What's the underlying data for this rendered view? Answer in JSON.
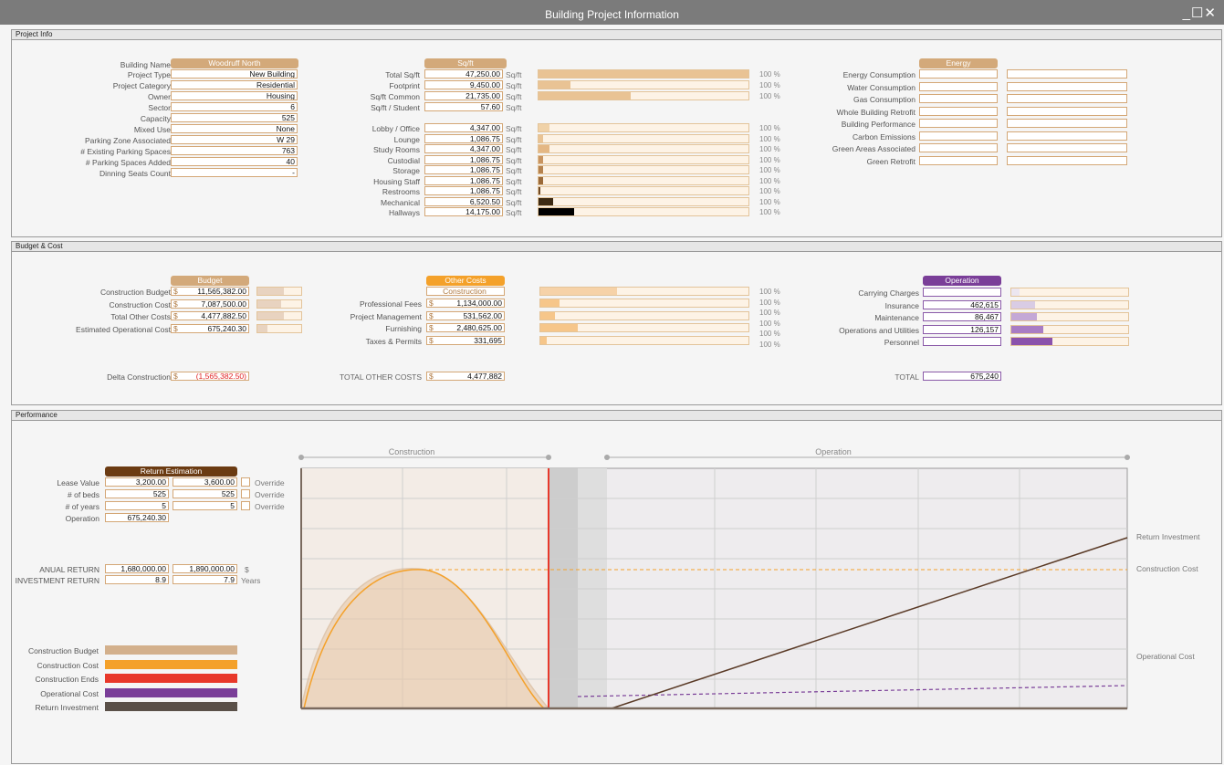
{
  "window": {
    "title": "Building Project Information",
    "controls": "_☐✕"
  },
  "project_info": {
    "header": "Project Info",
    "building_name_label": "Building Name",
    "building_name": "Woodruff North",
    "fields": [
      {
        "label": "Project Type",
        "value": "New Building"
      },
      {
        "label": "Project Category",
        "value": "Residential"
      },
      {
        "label": "Owner",
        "value": "Housing"
      },
      {
        "label": "Sector",
        "value": "6"
      },
      {
        "label": "Capacity",
        "value": "525"
      },
      {
        "label": "Mixed Use",
        "value": "None"
      },
      {
        "label": "Parking Zone Associated",
        "value": "W 29"
      },
      {
        "label": "# Existing Parking Spaces",
        "value": "763"
      },
      {
        "label": "# Parking Spaces Added",
        "value": "40"
      },
      {
        "label": "Dinning Seats Count",
        "value": "-"
      }
    ],
    "sqft_pill": "Sq/ft",
    "sqft_top": [
      {
        "label": "Total Sq/ft",
        "value": "47,250.00",
        "unit": "Sq/ft",
        "fill": 1.0,
        "pct": "100 %"
      },
      {
        "label": "Footprint",
        "value": "9,450.00",
        "unit": "Sq/ft",
        "fill": 0.15,
        "pct": "100 %"
      },
      {
        "label": "Sq/ft Common",
        "value": "21,735.00",
        "unit": "Sq/ft",
        "fill": 0.44,
        "pct": "100 %"
      },
      {
        "label": "Sq/ft / Student",
        "value": "57.60",
        "unit": "Sq/ft"
      }
    ],
    "sqft_rooms": [
      {
        "label": "Lobby / Office",
        "value": "4,347.00",
        "unit": "Sq/ft",
        "fill": 0.05,
        "pct": "100 %",
        "color": "#f0d2a8"
      },
      {
        "label": "Lounge",
        "value": "1,086.75",
        "unit": "Sq/ft",
        "fill": 0.02,
        "pct": "100 %",
        "color": "#e9c394"
      },
      {
        "label": "Study Rooms",
        "value": "4,347.00",
        "unit": "Sq/ft",
        "fill": 0.05,
        "pct": "100 %",
        "color": "#e4b784"
      },
      {
        "label": "Custodial",
        "value": "1,086.75",
        "unit": "Sq/ft",
        "fill": 0.02,
        "pct": "100 %",
        "color": "#c89460"
      },
      {
        "label": "Storage",
        "value": "1,086.75",
        "unit": "Sq/ft",
        "fill": 0.02,
        "pct": "100 %",
        "color": "#b5824e"
      },
      {
        "label": "Housing Staff",
        "value": "1,086.75",
        "unit": "Sq/ft",
        "fill": 0.02,
        "pct": "100 %",
        "color": "#9a6a3a"
      },
      {
        "label": "Restrooms",
        "value": "1,086.75",
        "unit": "Sq/ft",
        "fill": 0.01,
        "pct": "100 %",
        "color": "#6e4a26"
      },
      {
        "label": "Mechanical",
        "value": "6,520.50",
        "unit": "Sq/ft",
        "fill": 0.07,
        "pct": "100 %",
        "color": "#3c2a14"
      },
      {
        "label": "Hallways",
        "value": "14,175.00",
        "unit": "Sq/ft",
        "fill": 0.17,
        "pct": "100 %",
        "color": "#000000"
      }
    ],
    "energy_pill": "Energy",
    "energy": [
      {
        "label": "Energy Consumption"
      },
      {
        "label": "Water Consumption"
      },
      {
        "label": "Gas Consumption"
      },
      {
        "label": "Whole Building Retrofit"
      },
      {
        "label": "Building Performance"
      },
      {
        "label": "Carbon Emissions"
      },
      {
        "label": "Green Areas Associated"
      },
      {
        "label": "Green Retrofit"
      }
    ]
  },
  "budget": {
    "header": "Budget & Cost",
    "budget_pill": "Budget",
    "currency": "$",
    "rows": [
      {
        "label": "Construction Budget",
        "value": "11,565,382.00",
        "fill": 0.6
      },
      {
        "label": "Construction Cost",
        "value": "7,087,500.00",
        "fill": 0.55
      },
      {
        "label": "Total Other Costs",
        "value": "4,477,882.50",
        "fill": 0.6
      },
      {
        "label": "Estimated Operational Cost",
        "value": "675,240.30",
        "fill": 0.22
      }
    ],
    "delta_label": "Delta Construction",
    "delta_value": "(1,565,382.50)",
    "other_pill": "Other Costs",
    "other_sub": "Construction",
    "other_rows": [
      {
        "label": "Professional Fees",
        "value": "1,134,000.00",
        "fill": 0.09
      },
      {
        "label": "Project Management",
        "value": "531,562.00",
        "fill": 0.07
      },
      {
        "label": "Furnishing",
        "value": "2,480,625.00",
        "fill": 0.18
      },
      {
        "label": "Taxes & Permits",
        "value": "331,695",
        "fill": 0.03
      }
    ],
    "other_top_fill": 0.37,
    "other_pcts": [
      "100 %",
      "100 %",
      "100 %",
      "100 %",
      "100 %",
      "100 %"
    ],
    "total_other_label": "TOTAL OTHER COSTS",
    "total_other_value": "4,477,882",
    "operation_pill": "Operation",
    "op_rows": [
      {
        "label": "Carrying Charges",
        "value": "",
        "fill": 0.07
      },
      {
        "label": "Insurance",
        "value": "462,615",
        "fill": 0.2
      },
      {
        "label": "Maintenance",
        "value": "86,467",
        "fill": 0.22
      },
      {
        "label": "Operations and Utilities",
        "value": "126,157",
        "fill": 0.27
      },
      {
        "label": "Personnel",
        "value": "",
        "fill": 0.35
      }
    ],
    "total_label": "TOTAL",
    "total_value": "675,240"
  },
  "performance": {
    "header": "Performance",
    "return_pill": "Return Estimation",
    "rows": [
      {
        "label": "Lease Value",
        "v1": "3,200.00",
        "v2": "3,600.00",
        "override": "Override"
      },
      {
        "label": "# of beds",
        "v1": "525",
        "v2": "525",
        "override": "Override"
      },
      {
        "label": "# of years",
        "v1": "5",
        "v2": "5",
        "override": "Override"
      },
      {
        "label": "Operation",
        "v1": "675,240.30"
      }
    ],
    "annual_label": "ANUAL RETURN",
    "annual_v1": "1,680,000.00",
    "annual_v2": "1,890,000.00",
    "annual_unit": "$",
    "invest_label": "INVESTMENT RETURN",
    "invest_v1": "8.9",
    "invest_v2": "7.9",
    "invest_unit": "Years",
    "legend": [
      {
        "label": "Construction Budget",
        "color": "#d3b08c"
      },
      {
        "label": "Construction Cost",
        "color": "#f4a12a"
      },
      {
        "label": "Construction Ends",
        "color": "#e8382a"
      },
      {
        "label": "Operational Cost",
        "color": "#7a3e98"
      },
      {
        "label": "Return Investment",
        "color": "#5a5048"
      }
    ],
    "phase_construction": "Construction",
    "phase_operation": "Operation",
    "right_labels": {
      "return": "Return Investment",
      "cost": "Construction Cost",
      "op": "Operational Cost"
    }
  },
  "colors": {
    "tan": "#d3a97a",
    "orange": "#f4a12a",
    "purple": "#7a3e98",
    "brown": "#6b3b12"
  }
}
